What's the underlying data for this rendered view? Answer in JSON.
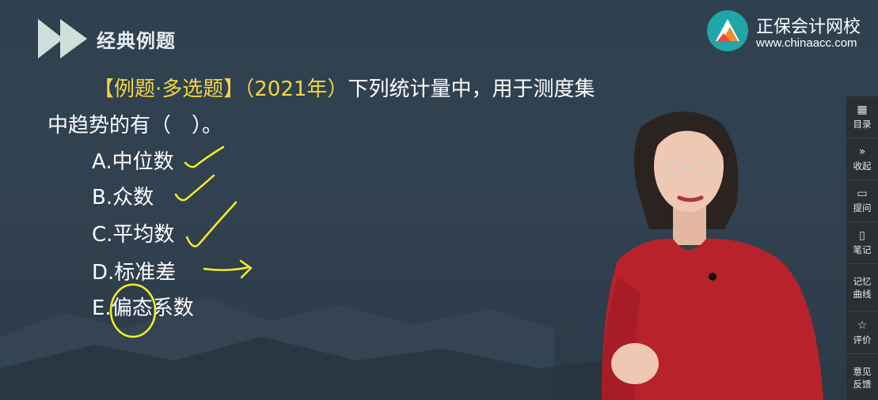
{
  "header": {
    "section_title": "经典例题",
    "brand_name": "正保会计网校",
    "brand_url": "www.chinaacc.com"
  },
  "question": {
    "tag": "【例题·多选题】",
    "year": "（2021年）",
    "text_line1": "下列统计量中，用于测度集",
    "text_line2": "中趋势的有（　）。"
  },
  "options": [
    {
      "label": "A.中位数"
    },
    {
      "label": "B.众数"
    },
    {
      "label": "C.平均数"
    },
    {
      "label": "D.标准差"
    },
    {
      "label": "E.偏态系数"
    }
  ],
  "toolbar": {
    "items": [
      {
        "icon": "grid-icon",
        "label": "目录"
      },
      {
        "icon": "chevrons-right-icon",
        "label": "收起"
      },
      {
        "icon": "chat-icon",
        "label": "提问"
      },
      {
        "icon": "note-icon",
        "label": "笔记"
      },
      {
        "label_line1": "记忆",
        "label_line2": "曲线"
      },
      {
        "icon": "star-icon",
        "label": "评价"
      },
      {
        "label_line1": "意见",
        "label_line2": "反馈"
      }
    ]
  },
  "colors": {
    "background": "#31414f",
    "accent_yellow": "#f3d641",
    "annotation_yellow": "#f5f020",
    "toolbar_bg": "#2b2f33",
    "presenter_dress": "#b8222a"
  }
}
